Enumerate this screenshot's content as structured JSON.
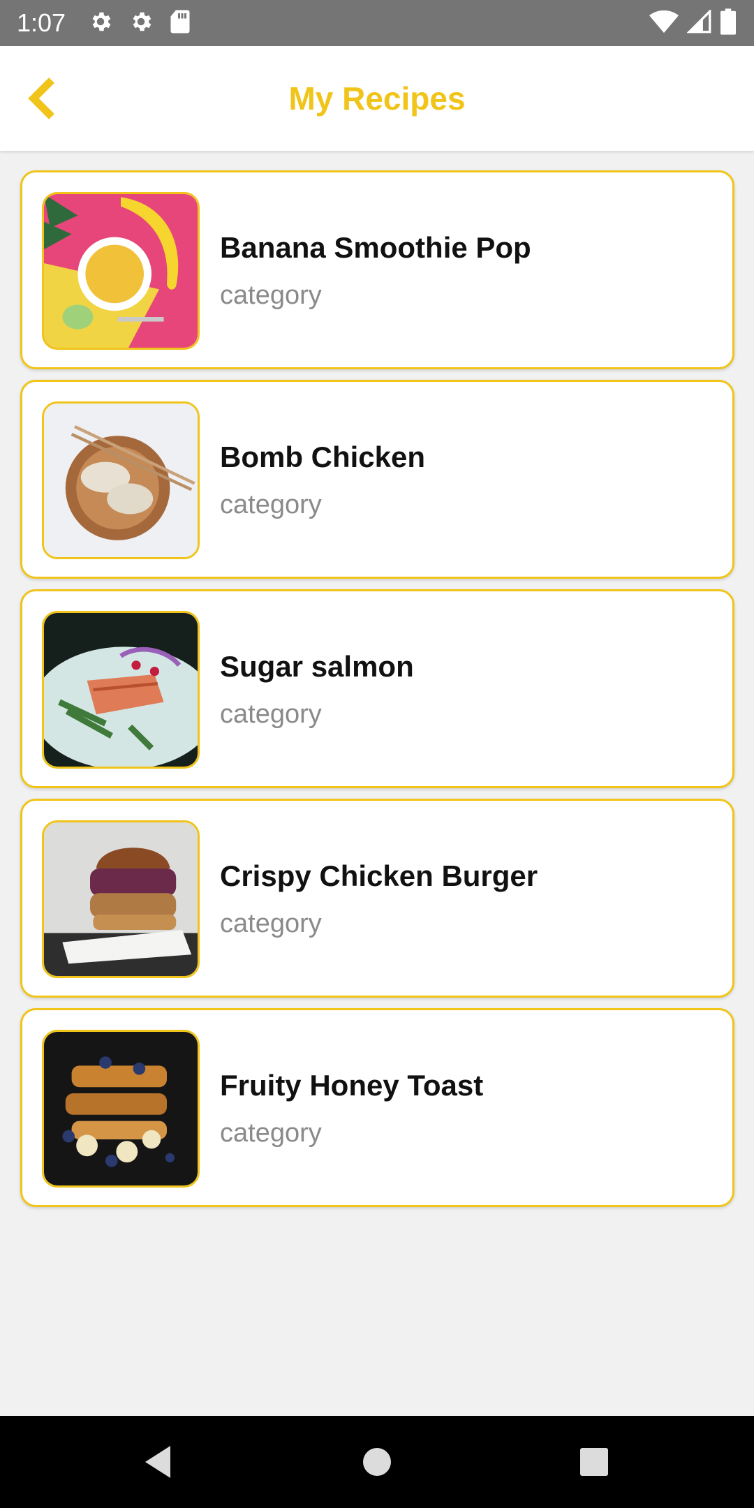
{
  "status_bar": {
    "time": "1:07",
    "left_icons": [
      "gear-icon",
      "gear-icon",
      "sd-card-icon"
    ],
    "right_icons": [
      "wifi-icon",
      "signal-icon",
      "battery-icon"
    ]
  },
  "app_bar": {
    "title": "My Recipes",
    "back_icon": "chevron-left-icon",
    "accent_color": "#f0c419"
  },
  "recipes": [
    {
      "name": "Banana Smoothie Pop",
      "category": "category"
    },
    {
      "name": "Bomb Chicken",
      "category": "category"
    },
    {
      "name": "Sugar salmon",
      "category": "category"
    },
    {
      "name": "Crispy Chicken Burger",
      "category": "category"
    },
    {
      "name": "Fruity Honey Toast",
      "category": "category"
    }
  ],
  "nav_bar": {
    "icons": [
      "back-triangle-icon",
      "home-circle-icon",
      "recents-square-icon"
    ]
  }
}
